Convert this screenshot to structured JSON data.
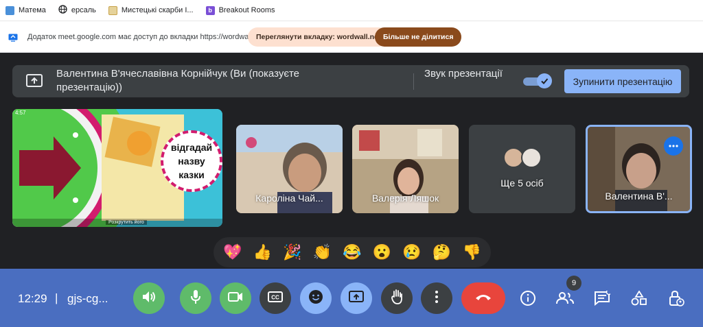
{
  "bookmarks": [
    {
      "label": "Матема",
      "icon": "image-icon",
      "color": "#4a90d9"
    },
    {
      "label": "ерсаль",
      "icon": "globe-icon",
      "color": "#202124"
    },
    {
      "label": "Мистецькі скарби І...",
      "icon": "folder-icon",
      "color": "#c7a24a"
    },
    {
      "label": "Breakout Rooms",
      "icon": "b-icon",
      "color": "#7a4fd6"
    }
  ],
  "sharebar": {
    "message": "Додаток meet.google.com має доступ до вкладки https://wordwall.net",
    "view_tab": "Переглянути вкладку: wordwall.net",
    "stop_sharing": "Більше не ділитися"
  },
  "banner": {
    "presenter": "Валентина В'ячеславівна Корнійчук (Ви (показуєте презентацію))",
    "sound_label": "Звук презентації",
    "sound_on": true,
    "stop_presentation": "Зупинити презентацію"
  },
  "presentation": {
    "timer": "4:57",
    "slide_text": "відгадай назву казки",
    "caption": "Розкрутить його"
  },
  "participants": [
    {
      "name": "Кароліна Чай..."
    },
    {
      "name": "Валерія Ляшок"
    },
    {
      "name": "Ще 5 осіб"
    },
    {
      "name": "Валентина В'..."
    }
  ],
  "reactions": [
    "💖",
    "👍",
    "🎉",
    "👏",
    "😂",
    "😮",
    "😢",
    "🤔",
    "👎"
  ],
  "bottom": {
    "time": "12:29",
    "separator": "|",
    "meeting_code": "gjs-cg...",
    "people_count": "9"
  },
  "colors": {
    "accent": "#8ab4f8",
    "bar": "#4a6ec0",
    "green": "#5fbb6a",
    "red": "#e8453c"
  }
}
